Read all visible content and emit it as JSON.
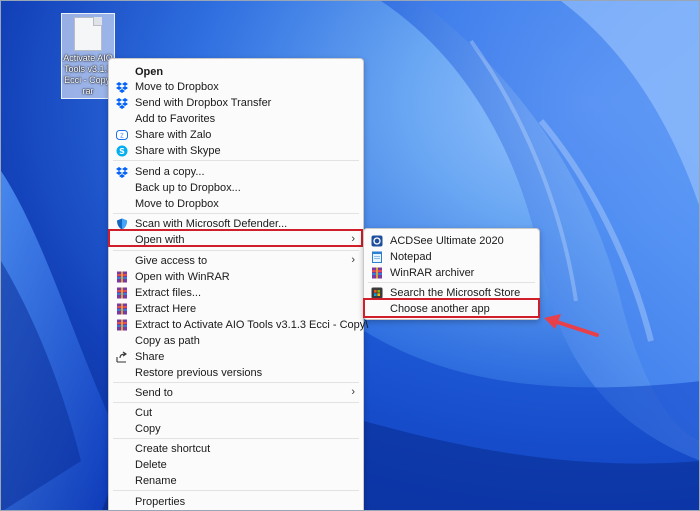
{
  "desktop": {
    "file_name": "Activate AIO Tools v3.1.3 Ecci - Copy.rar"
  },
  "context_menu": {
    "items": [
      {
        "label": "Open",
        "icon": "none"
      },
      {
        "label": "Move to Dropbox",
        "icon": "dropbox-icon"
      },
      {
        "label": "Send with Dropbox Transfer",
        "icon": "dropbox-icon"
      },
      {
        "label": "Add to Favorites",
        "icon": "none"
      },
      {
        "label": "Share with Zalo",
        "icon": "zalo-icon"
      },
      {
        "label": "Share with Skype",
        "icon": "skype-icon"
      },
      {
        "label": "Send a copy...",
        "icon": "dropbox-icon"
      },
      {
        "label": "Back up to Dropbox...",
        "icon": "none"
      },
      {
        "label": "Move to Dropbox",
        "icon": "none"
      },
      {
        "label": "Scan with Microsoft Defender...",
        "icon": "shield-icon"
      },
      {
        "label": "Open with",
        "icon": "none"
      },
      {
        "label": "Give access to",
        "icon": "none"
      },
      {
        "label": "Open with WinRAR",
        "icon": "winrar-icon"
      },
      {
        "label": "Extract files...",
        "icon": "winrar-icon"
      },
      {
        "label": "Extract Here",
        "icon": "winrar-icon"
      },
      {
        "label": "Extract to Activate AIO Tools v3.1.3 Ecci - Copy\\",
        "icon": "winrar-icon"
      },
      {
        "label": "Copy as path",
        "icon": "none"
      },
      {
        "label": "Share",
        "icon": "share-icon"
      },
      {
        "label": "Restore previous versions",
        "icon": "none"
      },
      {
        "label": "Send to",
        "icon": "none"
      },
      {
        "label": "Cut",
        "icon": "none"
      },
      {
        "label": "Copy",
        "icon": "none"
      },
      {
        "label": "Create shortcut",
        "icon": "none"
      },
      {
        "label": "Delete",
        "icon": "none"
      },
      {
        "label": "Rename",
        "icon": "none"
      },
      {
        "label": "Properties",
        "icon": "none"
      }
    ]
  },
  "open_with_submenu": {
    "items": [
      {
        "label": "ACDSee Ultimate 2020",
        "icon": "acdsee-icon"
      },
      {
        "label": "Notepad",
        "icon": "notepad-icon"
      },
      {
        "label": "WinRAR archiver",
        "icon": "winrar-icon"
      },
      {
        "label": "Search the Microsoft Store",
        "icon": "store-icon"
      },
      {
        "label": "Choose another app",
        "icon": "none"
      }
    ]
  },
  "colors": {
    "highlight_border": "#d01f2a",
    "arrow": "#e8404a",
    "menu_bg": "#fbfbfb"
  }
}
